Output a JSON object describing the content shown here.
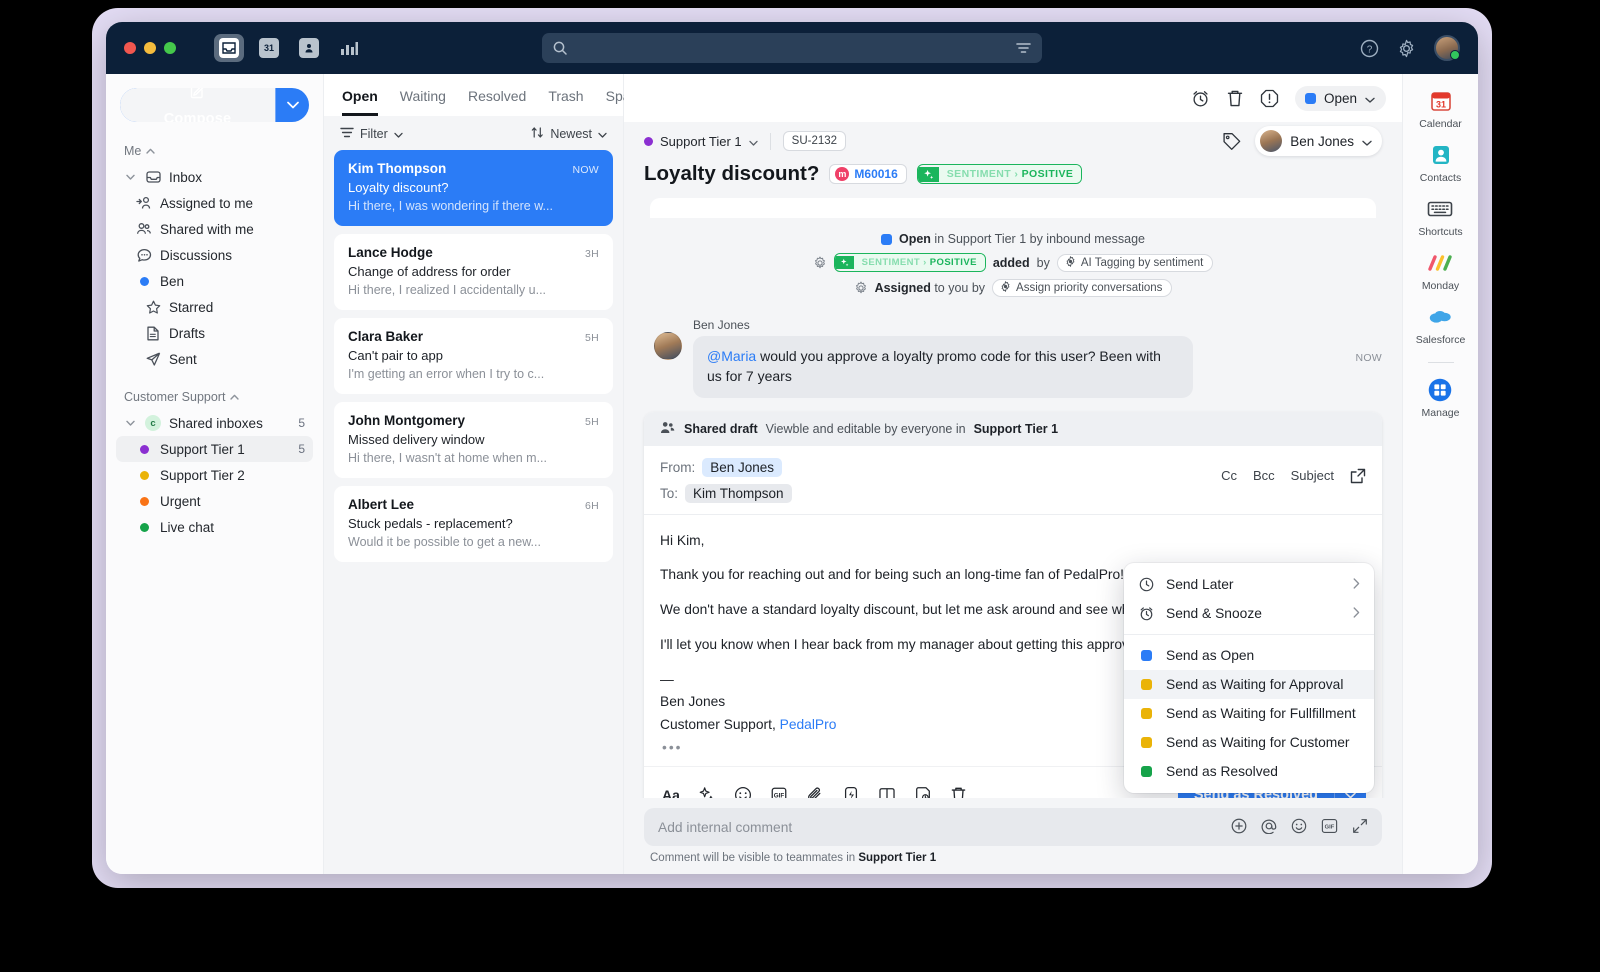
{
  "topbar": {
    "apps": [
      {
        "name": "inbox-app-icon",
        "glyph": "✉",
        "active": true
      },
      {
        "name": "calendar-app-icon",
        "glyph": "31",
        "active": false
      },
      {
        "name": "contacts-app-icon",
        "glyph": "👤",
        "active": false
      },
      {
        "name": "reports-app-icon",
        "glyph": "bars",
        "active": false
      }
    ],
    "search_placeholder": "",
    "help_label": "?",
    "settings_label": "gear"
  },
  "sidebar": {
    "compose_label": "Compose",
    "groups": [
      {
        "title": "Me",
        "items": [
          {
            "label": "Inbox",
            "icon": "inbox-icon",
            "indent": 0,
            "expander": true,
            "count": "",
            "selected": false
          },
          {
            "label": "Assigned to me",
            "icon": "assigned-icon",
            "indent": 1,
            "expander": false,
            "count": "",
            "selected": false
          },
          {
            "label": "Shared with me",
            "icon": "shared-icon",
            "indent": 1,
            "expander": false,
            "count": "",
            "selected": false
          },
          {
            "label": "Discussions",
            "icon": "discussions-icon",
            "indent": 1,
            "expander": false,
            "count": "",
            "selected": false
          },
          {
            "label": "Ben",
            "icon": "dot-blue",
            "indent": 1,
            "expander": false,
            "count": "",
            "selected": false,
            "color": "#2b7cf6"
          },
          {
            "label": "Starred",
            "icon": "star-icon",
            "indent": 0,
            "expander": false,
            "count": "",
            "selected": false
          },
          {
            "label": "Drafts",
            "icon": "draft-icon",
            "indent": 0,
            "expander": false,
            "count": "",
            "selected": false
          },
          {
            "label": "Sent",
            "icon": "sent-icon",
            "indent": 0,
            "expander": false,
            "count": "",
            "selected": false
          }
        ]
      },
      {
        "title": "Customer Support",
        "items": [
          {
            "label": "Shared inboxes",
            "icon": "c-badge",
            "indent": 0,
            "expander": true,
            "count": "5",
            "selected": false
          },
          {
            "label": "Support Tier 1",
            "icon": "dot",
            "indent": 1,
            "expander": false,
            "count": "5",
            "selected": true,
            "color": "#8b2fd1"
          },
          {
            "label": "Support Tier 2",
            "icon": "dot",
            "indent": 1,
            "expander": false,
            "count": "",
            "selected": false,
            "color": "#eab308"
          },
          {
            "label": "Urgent",
            "icon": "dot",
            "indent": 1,
            "expander": false,
            "count": "",
            "selected": false,
            "color": "#f97316"
          },
          {
            "label": "Live chat",
            "icon": "dot",
            "indent": 1,
            "expander": false,
            "count": "",
            "selected": false,
            "color": "#16a34a"
          }
        ]
      }
    ]
  },
  "list": {
    "tabs": [
      {
        "label": "Open",
        "active": true
      },
      {
        "label": "Waiting",
        "active": false
      },
      {
        "label": "Resolved",
        "active": false
      },
      {
        "label": "Trash",
        "active": false
      },
      {
        "label": "Spam",
        "active": false
      }
    ],
    "filter_label": "Filter",
    "sort_label": "Newest",
    "conversations": [
      {
        "name": "Kim Thompson",
        "time": "NOW",
        "subject": "Loyalty discount?",
        "preview": "Hi there, I was wondering if there w...",
        "active": true
      },
      {
        "name": "Lance Hodge",
        "time": "3H",
        "subject": "Change of address for order",
        "preview": "Hi there, I realized I accidentally u...",
        "active": false
      },
      {
        "name": "Clara Baker",
        "time": "5H",
        "subject": "Can't pair to app",
        "preview": "I'm getting an error when I try to c...",
        "active": false
      },
      {
        "name": "John Montgomery",
        "time": "5H",
        "subject": "Missed delivery window",
        "preview": "Hi there, I wasn't at home when m...",
        "active": false
      },
      {
        "name": "Albert Lee",
        "time": "6H",
        "subject": "Stuck pedals - replacement?",
        "preview": "Would it be possible to get a new...",
        "active": false
      }
    ]
  },
  "conversation": {
    "status_label": "Open",
    "status_color": "#2b7cf6",
    "inbox_label": "Support Tier 1",
    "inbox_color": "#8b2fd1",
    "ticket_id": "SU-2132",
    "assignee_name": "Ben Jones",
    "title": "Loyalty discount?",
    "merchant_chip": "M60016",
    "sentiment_label_key": "SENTIMENT",
    "sentiment_sep": "›",
    "sentiment_value": "POSITIVE",
    "events": [
      {
        "prefix_bold": "Open",
        "text": " in Support Tier 1 by inbound message",
        "icon": "status-square",
        "color": "#2b7cf6"
      },
      {
        "prefix_bold": "",
        "text": "added",
        "suffix": " by ",
        "automation": "AI Tagging by sentiment",
        "icon": "gear-icon",
        "has_tag": true
      },
      {
        "prefix_bold": "Assigned",
        "text": " to you by ",
        "automation": "Assign priority conversations",
        "icon": "gear-icon",
        "has_tag": false
      }
    ],
    "message": {
      "author": "Ben Jones",
      "mention": "@Maria",
      "text": " would you approve a loyalty promo code for this user? Been with us for 7 years",
      "time": "NOW"
    }
  },
  "draft": {
    "banner_bold": "Shared draft",
    "banner_text": "Viewble and editable by everyone in ",
    "banner_inbox": "Support Tier 1",
    "from_label": "From:",
    "from_value": "Ben Jones",
    "to_label": "To:",
    "to_value": "Kim Thompson",
    "cc_label": "Cc",
    "bcc_label": "Bcc",
    "subject_label": "Subject",
    "body": {
      "greeting": "Hi Kim,",
      "p1": "Thank you for reaching out and for being such an long-time fan of PedalPro! W",
      "p2": "We don't have a standard loyalty discount, but let me ask around and see wha",
      "p3": "I'll let you know when I hear back from my manager about getting this approve",
      "dash": "—",
      "sig_name": "Ben Jones",
      "sig_role": "Customer Support, ",
      "sig_company": "PedalPro",
      "ellipsis": "•••"
    },
    "tools": [
      {
        "name": "format-text-icon",
        "glyph": "Aa"
      },
      {
        "name": "ai-sparkle-icon",
        "glyph": "sparkle"
      },
      {
        "name": "emoji-icon",
        "glyph": "smiley"
      },
      {
        "name": "gif-icon",
        "glyph": "GIF"
      },
      {
        "name": "attachment-icon",
        "glyph": "paperclip"
      },
      {
        "name": "snippet-icon",
        "glyph": "bolt"
      },
      {
        "name": "knowledge-base-icon",
        "glyph": "book"
      },
      {
        "name": "save-template-icon",
        "glyph": "save"
      },
      {
        "name": "delete-draft-icon",
        "glyph": "trash"
      }
    ],
    "send_label": "Send as Resolved"
  },
  "send_menu": {
    "items": [
      {
        "label": "Send Later",
        "icon": "clock-icon",
        "submenu": true,
        "color": "",
        "highlighted": false
      },
      {
        "label": "Send & Snooze",
        "icon": "alarm-icon",
        "submenu": true,
        "color": "",
        "highlighted": false
      },
      {
        "label": "Send as Open",
        "icon": "status-square",
        "submenu": false,
        "color": "#2b7cf6",
        "highlighted": false
      },
      {
        "label": "Send as Waiting for Approval",
        "icon": "status-square",
        "submenu": false,
        "color": "#eab308",
        "highlighted": true
      },
      {
        "label": "Send as Waiting for Fullfillment",
        "icon": "status-square",
        "submenu": false,
        "color": "#eab308",
        "highlighted": false
      },
      {
        "label": "Send as Waiting for Customer",
        "icon": "status-square",
        "submenu": false,
        "color": "#eab308",
        "highlighted": false
      },
      {
        "label": "Send as Resolved",
        "icon": "status-square",
        "submenu": false,
        "color": "#16a34a",
        "highlighted": false
      }
    ]
  },
  "comment": {
    "placeholder": "Add internal comment",
    "hint_text": "Comment will be visible to teammates in ",
    "hint_inbox": "Support Tier 1"
  },
  "rail": {
    "items": [
      {
        "label": "Calendar",
        "icon": "calendar-icon"
      },
      {
        "label": "Contacts",
        "icon": "contacts-icon"
      },
      {
        "label": "Shortcuts",
        "icon": "keyboard-icon"
      },
      {
        "label": "Monday",
        "icon": "monday-icon"
      },
      {
        "label": "Salesforce",
        "icon": "salesforce-icon"
      },
      {
        "label": "Manage",
        "icon": "manage-icon"
      }
    ]
  }
}
